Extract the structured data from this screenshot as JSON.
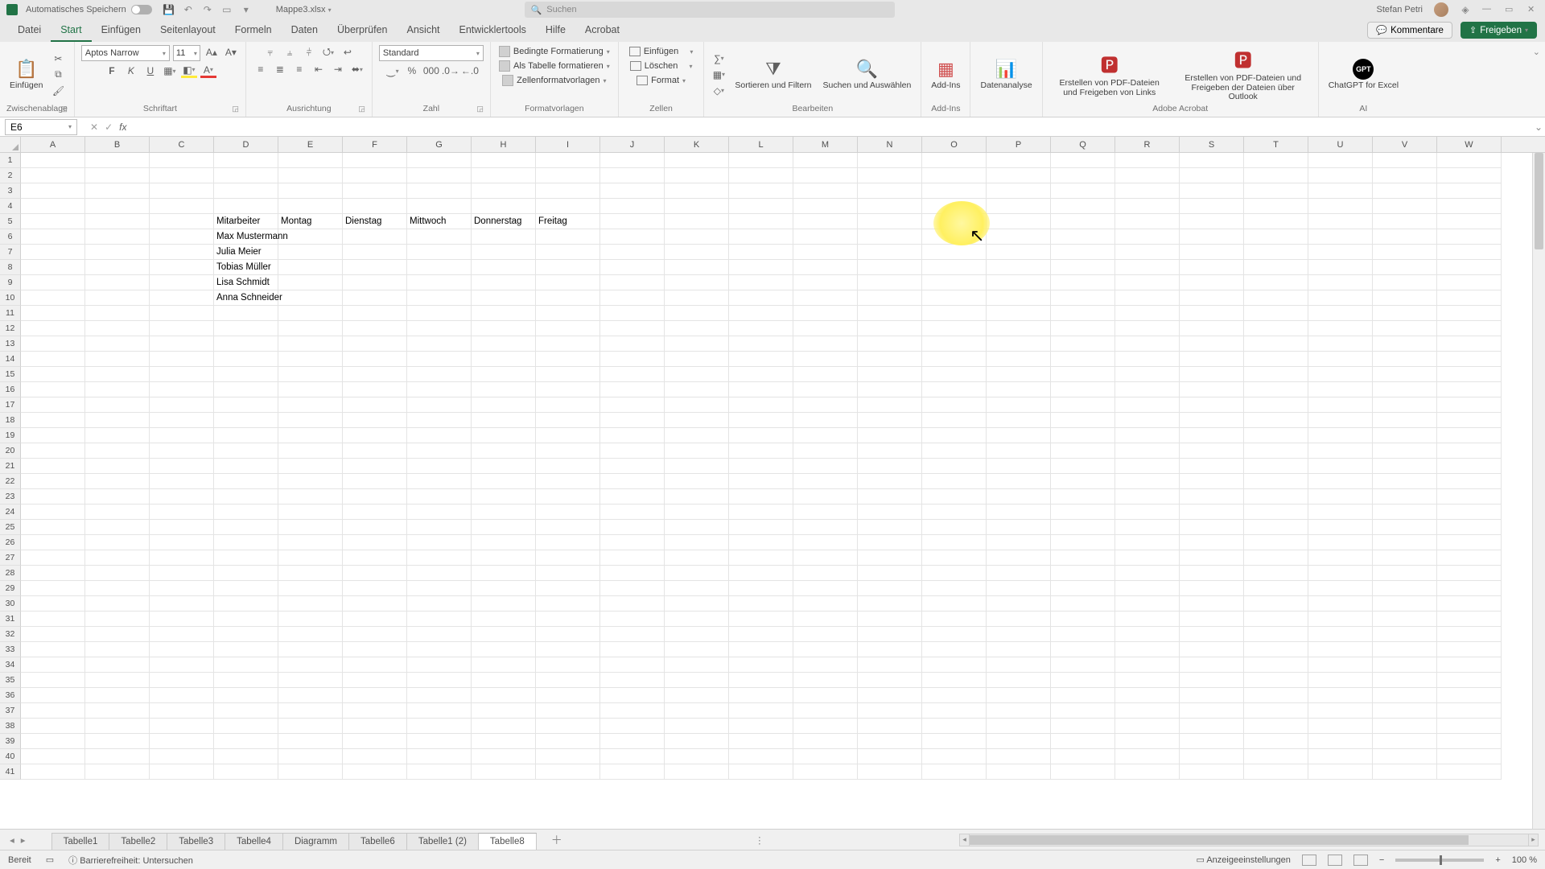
{
  "titlebar": {
    "autosave_label": "Automatisches Speichern",
    "filename": "Mappe3.xlsx",
    "search_placeholder": "Suchen",
    "username": "Stefan Petri"
  },
  "tabs": {
    "items": [
      "Datei",
      "Start",
      "Einfügen",
      "Seitenlayout",
      "Formeln",
      "Daten",
      "Überprüfen",
      "Ansicht",
      "Entwicklertools",
      "Hilfe",
      "Acrobat"
    ],
    "active_index": 1,
    "comments": "Kommentare",
    "share": "Freigeben"
  },
  "ribbon": {
    "clipboard": {
      "paste": "Einfügen",
      "label": "Zwischenablage"
    },
    "font": {
      "name": "Aptos Narrow",
      "size": "11",
      "label": "Schriftart"
    },
    "align": {
      "label": "Ausrichtung"
    },
    "number": {
      "format": "Standard",
      "label": "Zahl"
    },
    "styles": {
      "cond": "Bedingte Formatierung",
      "astable": "Als Tabelle formatieren",
      "cellstyles": "Zellenformatvorlagen",
      "label": "Formatvorlagen"
    },
    "cells": {
      "insert": "Einfügen",
      "delete": "Löschen",
      "format": "Format",
      "label": "Zellen"
    },
    "editing": {
      "sort": "Sortieren und Filtern",
      "find": "Suchen und Auswählen",
      "label": "Bearbeiten"
    },
    "addins": {
      "btn": "Add-Ins",
      "label": "Add-Ins"
    },
    "analysis": {
      "btn": "Datenanalyse"
    },
    "acrobat": {
      "b1": "Erstellen von PDF-Dateien und Freigeben von Links",
      "b2": "Erstellen von PDF-Dateien und Freigeben der Dateien über Outlook",
      "label": "Adobe Acrobat"
    },
    "ai": {
      "btn": "ChatGPT for Excel",
      "label": "AI"
    }
  },
  "namebox": {
    "ref": "E6"
  },
  "columns": [
    "A",
    "B",
    "C",
    "D",
    "E",
    "F",
    "G",
    "H",
    "I",
    "J",
    "K",
    "L",
    "M",
    "N",
    "O",
    "P",
    "Q",
    "R",
    "S",
    "T",
    "U",
    "V",
    "W"
  ],
  "row_count": 41,
  "cells": {
    "D5": "Mitarbeiter",
    "E5": "Montag",
    "F5": "Dienstag",
    "G5": "Mittwoch",
    "H5": "Donnerstag",
    "I5": "Freitag",
    "D6": "Max Mustermann",
    "D7": "Julia Meier",
    "D8": "Tobias Müller",
    "D9": "Lisa Schmidt",
    "D10": "Anna Schneider"
  },
  "sheets": {
    "items": [
      "Tabelle1",
      "Tabelle2",
      "Tabelle3",
      "Tabelle4",
      "Diagramm",
      "Tabelle6",
      "Tabelle1 (2)",
      "Tabelle8"
    ],
    "active_index": 7
  },
  "status": {
    "ready": "Bereit",
    "access": "Barrierefreiheit: Untersuchen",
    "display": "Anzeigeeinstellungen",
    "zoom": "100 %"
  }
}
